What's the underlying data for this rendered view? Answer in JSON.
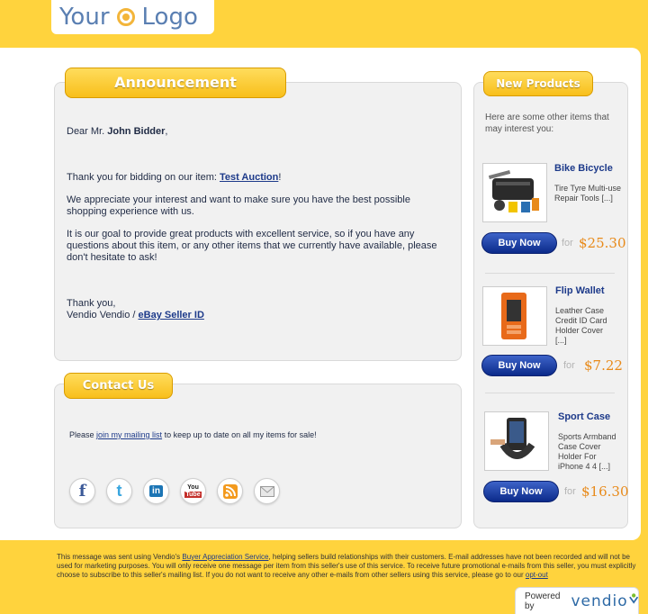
{
  "logo": {
    "text_left": "Your",
    "text_right": "Logo"
  },
  "announcement": {
    "tab_label": "Announcement",
    "greeting_prefix": "Dear Mr. ",
    "bidder_name": "John Bidder",
    "greeting_suffix": ",",
    "thanks_prefix": "Thank you for bidding on our item: ",
    "item_link": "Test Auction",
    "thanks_suffix": "!",
    "paragraph_2": "We appreciate your interest and want to make sure you have the best possible shopping experience with us.",
    "paragraph_3": "It is our goal to provide great products with excellent service, so if you have any questions about this item, or any other items that we currently have available, please don't hesitate to ask!",
    "sign_off": "Thank you,",
    "seller_name": "Vendio Vendio / ",
    "seller_link": "eBay Seller ID"
  },
  "contact": {
    "tab_label": "Contact Us",
    "text_prefix": "Please ",
    "mailing_link": "join my mailing list",
    "text_suffix": " to keep up to date on all my items for sale!",
    "social_icons": [
      "facebook-icon",
      "twitter-icon",
      "linkedin-icon",
      "youtube-icon",
      "rss-icon",
      "email-icon"
    ]
  },
  "new_products": {
    "tab_label": "New Products",
    "intro": "Here are some other items that may interest you:",
    "items": [
      {
        "title": "Bike Bicycle",
        "desc": "Tire Tyre Multi-use Repair Tools [...]",
        "buy": "Buy Now",
        "for": "for",
        "price": "$25.30"
      },
      {
        "title": "Flip Wallet",
        "desc": "Leather Case Credit ID Card Holder Cover [...]",
        "buy": "Buy Now",
        "for": "for",
        "price": "$7.22"
      },
      {
        "title": "Sport Case",
        "desc": "Sports Armband Case Cover Holder For iPhone 4 4 [...]",
        "buy": "Buy Now",
        "for": "for",
        "price": "$16.30"
      }
    ]
  },
  "footer": {
    "text_1": "This message was sent using Vendio's ",
    "link_1": "Buyer Appreciation Service",
    "text_2": ", helping sellers build relationships with their customers. E-mail addresses have not been recorded and will not be used for marketing purposes. You will only receive one message per item from this seller's use of this service. To receive future promotional e-mails from this seller, you must explicitly choose to subscribe to this seller's mailing list. If you do not want to receive any other e-mails from other sellers using this service, please go to our ",
    "link_2": "opt-out",
    "powered_by": "Powered by",
    "brand": "vendio"
  },
  "colors": {
    "background": "#ffd33d",
    "tab": "#f8bf1b",
    "buy_button": "#0b2a8a",
    "price": "#e88a1a"
  }
}
